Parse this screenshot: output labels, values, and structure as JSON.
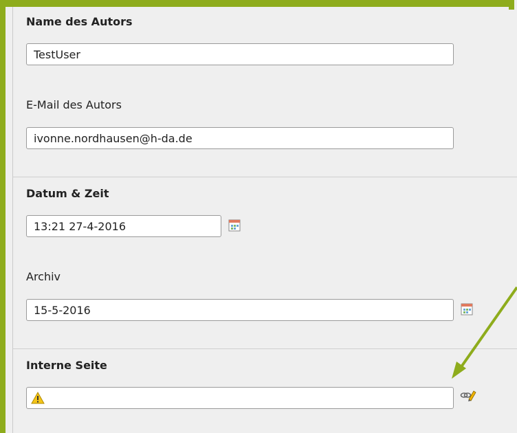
{
  "author_section": {
    "name_label": "Name des Autors",
    "name_value": "TestUser",
    "email_label": "E-Mail des Autors",
    "email_value": "ivonne.nordhausen@h-da.de"
  },
  "date_section": {
    "datetime_label": "Datum & Zeit",
    "datetime_value": "13:21 27-4-2016",
    "archive_label": "Archiv",
    "archive_value": "15-5-2016"
  },
  "internal_section": {
    "page_label": "Interne Seite",
    "page_value": ""
  },
  "icons": {
    "calendar": "calendar-icon",
    "warning": "warning-icon",
    "link": "link-pencil-icon"
  },
  "colors": {
    "highlight_frame": "#8eac1c",
    "panel_bg": "#efefef"
  }
}
